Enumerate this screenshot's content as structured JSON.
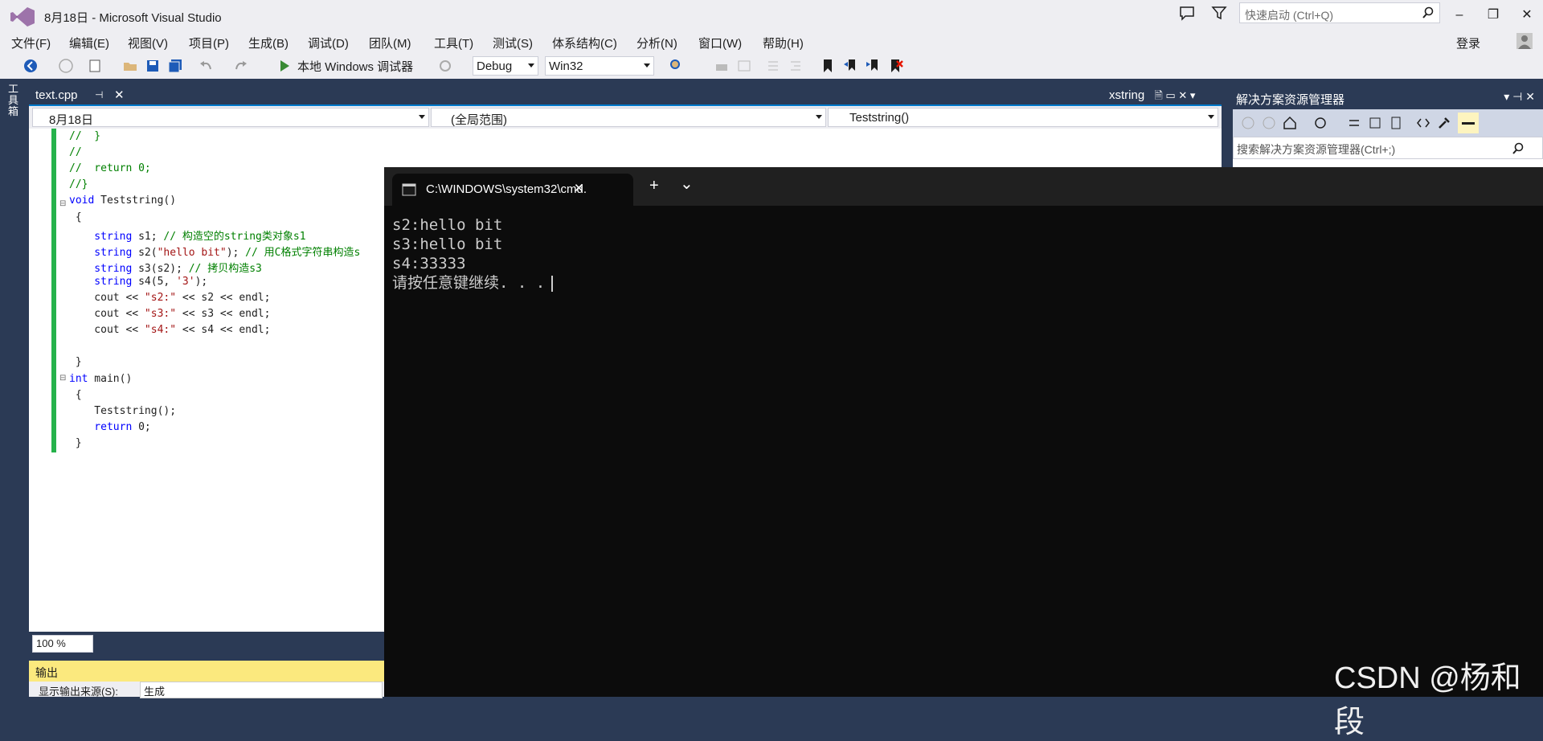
{
  "window": {
    "title": "8月18日 - Microsoft Visual Studio",
    "quick_launch_placeholder": "快速启动 (Ctrl+Q)"
  },
  "menu": [
    "文件(F)",
    "编辑(E)",
    "视图(V)",
    "项目(P)",
    "生成(B)",
    "调试(D)",
    "团队(M)",
    "工具(T)",
    "测试(S)",
    "体系结构(C)",
    "分析(N)",
    "窗口(W)",
    "帮助(H)"
  ],
  "login_label": "登录",
  "toolbar": {
    "run_label": "本地 Windows 调试器",
    "config": "Debug",
    "platform": "Win32"
  },
  "left_rail": {
    "toolbox_label": "工具箱"
  },
  "editor": {
    "tab_label": "text.cpp",
    "tab_pin": "⊣",
    "tab_close": "✕",
    "secondary_tab_label": "xstring",
    "nav_project": "8月18日",
    "nav_scope": "(全局范围)",
    "nav_member": "Teststring()",
    "zoom": "100 %",
    "lines": [
      {
        "segments": [
          {
            "t": "//  }",
            "c": "cm"
          }
        ]
      },
      {
        "segments": [
          {
            "t": "//",
            "c": "cm"
          }
        ]
      },
      {
        "segments": [
          {
            "t": "//  return 0;",
            "c": "cm"
          }
        ]
      },
      {
        "segments": [
          {
            "t": "//}",
            "c": "cm"
          }
        ]
      },
      {
        "segments": [
          {
            "t": "void",
            "c": "kw"
          },
          {
            "t": " Teststring()",
            "c": ""
          }
        ]
      },
      {
        "segments": [
          {
            "t": " {",
            "c": ""
          }
        ]
      },
      {
        "segments": [
          {
            "t": "    string",
            "c": "kw"
          },
          {
            "t": " s1; ",
            "c": ""
          },
          {
            "t": "// 构造空的string类对象s1",
            "c": "cm"
          }
        ]
      },
      {
        "segments": [
          {
            "t": "    string",
            "c": "kw"
          },
          {
            "t": " s2(",
            "c": ""
          },
          {
            "t": "\"hello bit\"",
            "c": "st"
          },
          {
            "t": "); ",
            "c": ""
          },
          {
            "t": "// 用C格式字符串构造s",
            "c": "cm"
          }
        ]
      },
      {
        "segments": [
          {
            "t": "    string",
            "c": "kw"
          },
          {
            "t": " s3(s2); ",
            "c": ""
          },
          {
            "t": "// 拷贝构造s3",
            "c": "cm"
          }
        ]
      },
      {
        "segments": [
          {
            "t": "    string",
            "c": "kw"
          },
          {
            "t": " s4(5, ",
            "c": ""
          },
          {
            "t": "'3'",
            "c": "st"
          },
          {
            "t": ");",
            "c": ""
          }
        ]
      },
      {
        "segments": [
          {
            "t": "    cout << ",
            "c": ""
          },
          {
            "t": "\"s2:\"",
            "c": "st"
          },
          {
            "t": " << s2 << endl;",
            "c": ""
          }
        ]
      },
      {
        "segments": [
          {
            "t": "    cout << ",
            "c": ""
          },
          {
            "t": "\"s3:\"",
            "c": "st"
          },
          {
            "t": " << s3 << endl;",
            "c": ""
          }
        ]
      },
      {
        "segments": [
          {
            "t": "    cout << ",
            "c": ""
          },
          {
            "t": "\"s4:\"",
            "c": "st"
          },
          {
            "t": " << s4 << endl;",
            "c": ""
          }
        ]
      },
      {
        "segments": [
          {
            "t": "",
            "c": ""
          }
        ]
      },
      {
        "segments": [
          {
            "t": " }",
            "c": ""
          }
        ]
      },
      {
        "segments": [
          {
            "t": "int",
            "c": "kw"
          },
          {
            "t": " main()",
            "c": ""
          }
        ]
      },
      {
        "segments": [
          {
            "t": " {",
            "c": ""
          }
        ]
      },
      {
        "segments": [
          {
            "t": "    Teststring();",
            "c": ""
          }
        ]
      },
      {
        "segments": [
          {
            "t": "    return",
            "c": "kw"
          },
          {
            "t": " 0;",
            "c": ""
          }
        ]
      },
      {
        "segments": [
          {
            "t": " }",
            "c": ""
          }
        ]
      }
    ]
  },
  "output": {
    "header": "输出",
    "source_label": "显示输出来源(S):",
    "source_value": "生成"
  },
  "solution_explorer": {
    "title": "解决方案资源管理器",
    "search_placeholder": "搜索解决方案资源管理器(Ctrl+;)"
  },
  "console": {
    "tab_title": "C:\\WINDOWS\\system32\\cmd.",
    "tab_close": "✕",
    "new_tab": "+",
    "dropdown": "⌄",
    "lines": [
      "s2:hello bit",
      "s3:hello bit",
      "s4:33333",
      "请按任意键继续. . ."
    ]
  },
  "watermark": "CSDN @杨和段",
  "colors": {
    "vs_chrome": "#eeeef2",
    "vs_dark": "#2b3a55",
    "console_bg": "#0c0c0c",
    "output_header": "#fbe97e"
  }
}
